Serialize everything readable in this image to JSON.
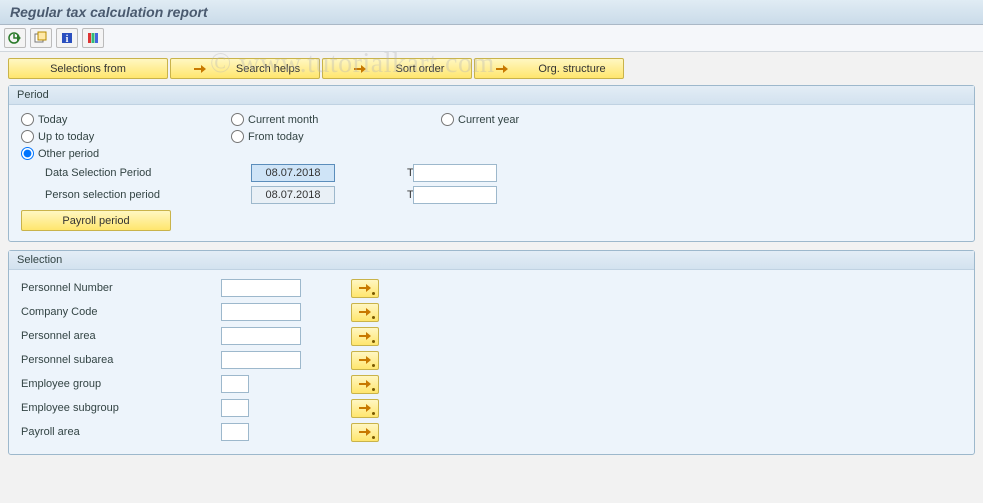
{
  "title": "Regular tax calculation report",
  "watermark": "© www.tutorialkart.com",
  "toolbar": {
    "execute": "execute",
    "variants": "variants",
    "info": "info",
    "layout": "layout"
  },
  "buttons": {
    "selections_from": "Selections from",
    "search_helps": "Search helps",
    "sort_order": "Sort order",
    "org_structure": "Org. structure"
  },
  "period": {
    "header": "Period",
    "today": "Today",
    "current_month": "Current month",
    "current_year": "Current year",
    "up_to_today": "Up to today",
    "from_today": "From today",
    "other_period": "Other period",
    "selected": "other_period",
    "data_sel_label": "Data Selection Period",
    "data_sel_value": "08.07.2018",
    "person_sel_label": "Person selection period",
    "person_sel_value": "08.07.2018",
    "to_label": "To",
    "data_to_value": "",
    "person_to_value": "",
    "payroll_period_btn": "Payroll period"
  },
  "selection": {
    "header": "Selection",
    "rows": [
      {
        "label": "Personnel Number",
        "value": "",
        "size": "std"
      },
      {
        "label": "Company Code",
        "value": "",
        "size": "std"
      },
      {
        "label": "Personnel area",
        "value": "",
        "size": "std"
      },
      {
        "label": "Personnel subarea",
        "value": "",
        "size": "std"
      },
      {
        "label": "Employee group",
        "value": "",
        "size": "short"
      },
      {
        "label": "Employee subgroup",
        "value": "",
        "size": "short"
      },
      {
        "label": "Payroll area",
        "value": "",
        "size": "short"
      }
    ]
  }
}
